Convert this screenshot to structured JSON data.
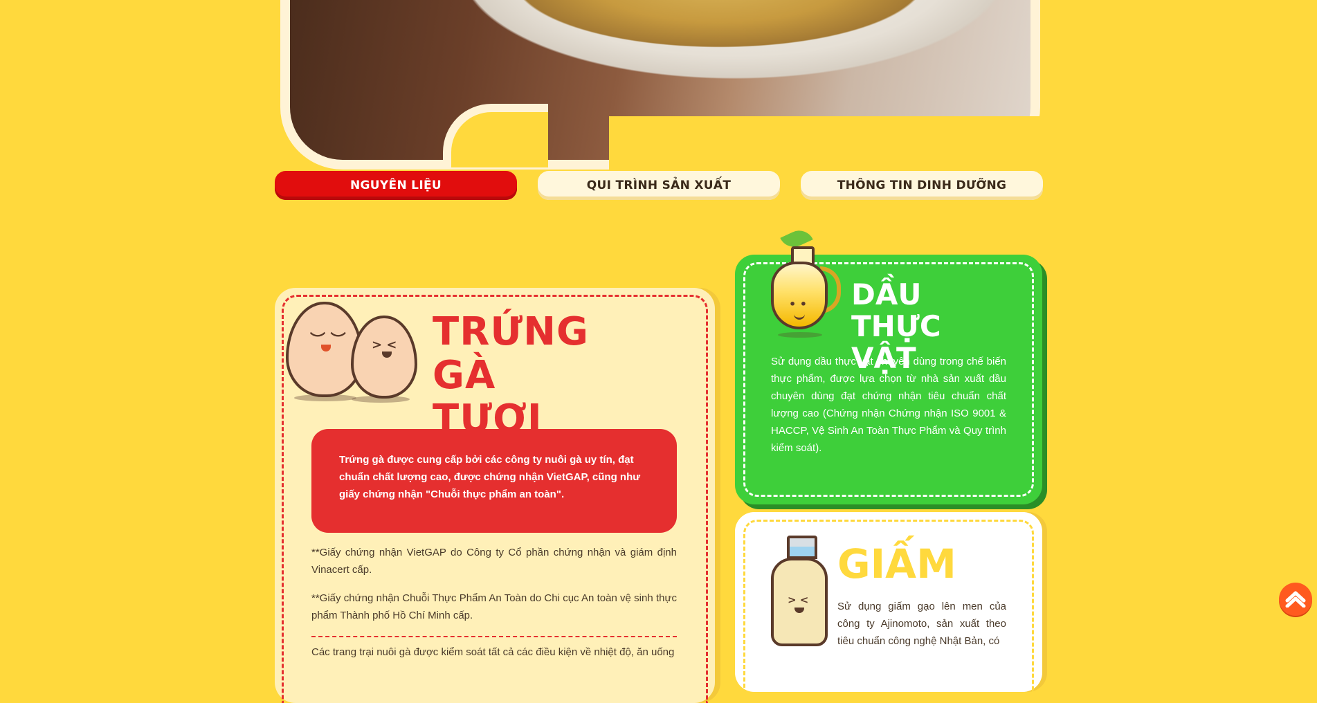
{
  "tabs": [
    {
      "label": "NGUYÊN LIỆU",
      "active": true
    },
    {
      "label": "QUI TRÌNH SẢN XUẤT",
      "active": false
    },
    {
      "label": "THÔNG TIN DINH DƯỠNG",
      "active": false
    }
  ],
  "egg_section": {
    "title_line1": "TRỨNG GÀ",
    "title_line2": "TƯƠI",
    "highlight": "Trứng gà được cung cấp bởi các công ty nuôi gà uy tín, đạt chuẩn chất lượng cao, được chứng nhận VietGAP, cũng như giấy chứng nhận \"Chuỗi thực phẩm an toàn\".",
    "note1": "**Giấy chứng nhận VietGAP do Công ty Cổ phần chứng nhận và giám định Vinacert cấp.",
    "note2": "**Giấy chứng nhận Chuỗi Thực Phẩm An Toàn do Chi cục An toàn vệ sinh thực phẩm Thành phố Hồ Chí Minh cấp.",
    "note3": "Các trang trại nuôi gà được kiểm soát tất cả các điều kiện về nhiệt độ, ăn uống"
  },
  "oil_section": {
    "title_line1": "DẦU THỰC",
    "title_line2": "VẬT",
    "body": "Sử dụng dầu thực vật chuyên dùng trong chế biến thực phẩm, được lựa chọn từ nhà sản xuất dầu chuyên dùng đạt chứng nhận tiêu chuẩn chất lượng cao (Chứng nhận Chứng nhận ISO 9001 & HACCP, Vệ Sinh An Toàn Thực Phẩm và Quy trình kiểm soát)."
  },
  "vinegar_section": {
    "title": "GIẤM",
    "body": "Sử dụng giấm gạo lên men của công ty Ajinomoto, sản xuất theo tiêu chuẩn công nghệ Nhật Bản, có"
  },
  "colors": {
    "background": "#ffd93d",
    "tab_active": "#e10d0d",
    "egg_red": "#e52f2f",
    "oil_green": "#3ecf3a",
    "scroll_button": "#ff5a1f"
  },
  "icons": {
    "scroll_top": "chevron-up-icon",
    "eggs": "eggs-mascot-icon",
    "oil": "oil-bottle-mascot-icon",
    "vinegar": "vinegar-bottle-mascot-icon"
  }
}
